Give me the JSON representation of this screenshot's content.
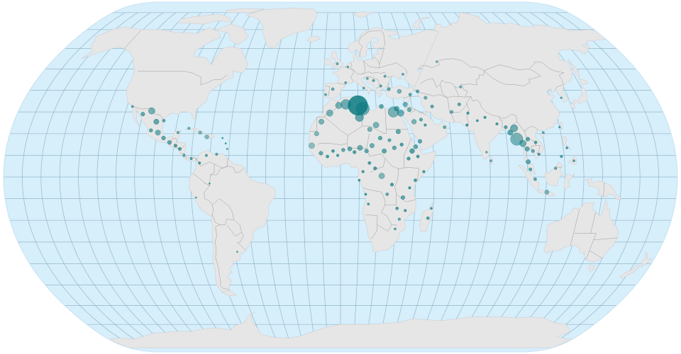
{
  "map": {
    "projection": "natural-earth",
    "colors": {
      "ocean": "#d7eefb",
      "ocean_edge": "#c8e4f4",
      "land": "#e6e6e6",
      "graticule": "#7fa7b8",
      "marker": "#0b7a80"
    },
    "graticule_step_deg": 10,
    "markers": [
      {
        "lon": 9.8,
        "lat": 33.0,
        "size": 6,
        "opacity": 0.85
      },
      {
        "lon": 12.5,
        "lat": 31.5,
        "size": 4,
        "opacity": 0.55
      },
      {
        "lon": 10.5,
        "lat": 27.5,
        "size": 2.5,
        "opacity": 0.6
      },
      {
        "lon": 3.0,
        "lat": 33.5,
        "size": 3,
        "opacity": 0.55
      },
      {
        "lon": -1.0,
        "lat": 33.0,
        "size": 2,
        "opacity": 0.5
      },
      {
        "lon": -6.0,
        "lat": 29.5,
        "size": 2,
        "opacity": 0.5
      },
      {
        "lon": -10.5,
        "lat": 25.5,
        "size": 1.6,
        "opacity": 0.5
      },
      {
        "lon": -13.0,
        "lat": 20.0,
        "size": 1.4,
        "opacity": 0.45
      },
      {
        "lon": -15.5,
        "lat": 14.5,
        "size": 1.8,
        "opacity": 0.4
      },
      {
        "lon": -10.5,
        "lat": 11.0,
        "size": 1.2,
        "opacity": 0.6
      },
      {
        "lon": -7.0,
        "lat": 9.5,
        "size": 0.9,
        "opacity": 0.7
      },
      {
        "lon": -4.0,
        "lat": 12.0,
        "size": 0.9,
        "opacity": 0.7
      },
      {
        "lon": -1.5,
        "lat": 10.0,
        "size": 0.8,
        "opacity": 0.7
      },
      {
        "lon": 1.5,
        "lat": 12.5,
        "size": 1.1,
        "opacity": 0.6
      },
      {
        "lon": 5.0,
        "lat": 13.0,
        "size": 1.3,
        "opacity": 0.6
      },
      {
        "lon": 7.5,
        "lat": 11.5,
        "size": 1.0,
        "opacity": 0.7
      },
      {
        "lon": 10.5,
        "lat": 13.5,
        "size": 1.6,
        "opacity": 0.55
      },
      {
        "lon": 14.0,
        "lat": 12.0,
        "size": 1.2,
        "opacity": 0.6
      },
      {
        "lon": 17.0,
        "lat": 14.5,
        "size": 1.4,
        "opacity": 0.55
      },
      {
        "lon": 16.0,
        "lat": 22.0,
        "size": 1.4,
        "opacity": 0.5
      },
      {
        "lon": 19.5,
        "lat": 24.0,
        "size": 1.8,
        "opacity": 0.5
      },
      {
        "lon": 21.5,
        "lat": 18.0,
        "size": 1.2,
        "opacity": 0.6
      },
      {
        "lon": 23.5,
        "lat": 12.0,
        "size": 1.4,
        "opacity": 0.6
      },
      {
        "lon": 26.5,
        "lat": 17.0,
        "size": 1.0,
        "opacity": 0.6
      },
      {
        "lon": 29.0,
        "lat": 13.5,
        "size": 1.2,
        "opacity": 0.6
      },
      {
        "lon": 31.5,
        "lat": 21.0,
        "size": 1.4,
        "opacity": 0.6
      },
      {
        "lon": 33.0,
        "lat": 15.0,
        "size": 1.0,
        "opacity": 0.7
      },
      {
        "lon": 29.5,
        "lat": 30.0,
        "size": 3.2,
        "opacity": 0.5
      },
      {
        "lon": 33.5,
        "lat": 29.5,
        "size": 2.0,
        "opacity": 0.55
      },
      {
        "lon": 31.5,
        "lat": 31.5,
        "size": 1.5,
        "opacity": 0.6
      },
      {
        "lon": 23.0,
        "lat": 32.5,
        "size": 1.3,
        "opacity": 0.6
      },
      {
        "lon": 36.5,
        "lat": 33.5,
        "size": 1.4,
        "opacity": 0.55
      },
      {
        "lon": 38.5,
        "lat": 31.0,
        "size": 1.2,
        "opacity": 0.55
      },
      {
        "lon": 40.5,
        "lat": 25.5,
        "size": 1.5,
        "opacity": 0.5
      },
      {
        "lon": 44.5,
        "lat": 26.5,
        "size": 1.0,
        "opacity": 0.6
      },
      {
        "lon": 46.5,
        "lat": 24.0,
        "size": 0.8,
        "opacity": 0.7
      },
      {
        "lon": 43.0,
        "lat": 16.5,
        "size": 1.2,
        "opacity": 0.6
      },
      {
        "lon": 40.5,
        "lat": 14.0,
        "size": 1.3,
        "opacity": 0.6
      },
      {
        "lon": 38.5,
        "lat": 12.0,
        "size": 1.5,
        "opacity": 0.65
      },
      {
        "lon": 36.5,
        "lat": 8.5,
        "size": 1.0,
        "opacity": 0.7
      },
      {
        "lon": 41.5,
        "lat": 9.5,
        "size": 0.9,
        "opacity": 0.7
      },
      {
        "lon": 44.5,
        "lat": 2.5,
        "size": 0.8,
        "opacity": 0.7
      },
      {
        "lon": 40.0,
        "lat": -1.5,
        "size": 0.9,
        "opacity": 0.7
      },
      {
        "lon": 37.0,
        "lat": -5.0,
        "size": 0.8,
        "opacity": 0.7
      },
      {
        "lon": 33.5,
        "lat": -9.5,
        "size": 1.2,
        "opacity": 0.6
      },
      {
        "lon": 30.5,
        "lat": -14.5,
        "size": 0.9,
        "opacity": 0.65
      },
      {
        "lon": 35.0,
        "lat": -15.5,
        "size": 0.8,
        "opacity": 0.7
      },
      {
        "lon": 32.0,
        "lat": -19.5,
        "size": 0.8,
        "opacity": 0.6
      },
      {
        "lon": 30.0,
        "lat": -24.0,
        "size": 0.7,
        "opacity": 0.6
      },
      {
        "lon": 27.5,
        "lat": -3.5,
        "size": 1.0,
        "opacity": 0.7
      },
      {
        "lon": 25.0,
        "lat": -8.0,
        "size": 0.9,
        "opacity": 0.6
      },
      {
        "lon": 22.0,
        "lat": 0.5,
        "size": 1.8,
        "opacity": 0.45
      },
      {
        "lon": 18.5,
        "lat": 4.0,
        "size": 1.0,
        "opacity": 0.7
      },
      {
        "lon": 15.5,
        "lat": 6.5,
        "size": 0.9,
        "opacity": 0.7
      },
      {
        "lon": 12.0,
        "lat": 2.5,
        "size": 0.8,
        "opacity": 0.7
      },
      {
        "lon": 10.0,
        "lat": -1.5,
        "size": 0.7,
        "opacity": 0.7
      },
      {
        "lon": 13.5,
        "lat": -8.0,
        "size": 0.7,
        "opacity": 0.7
      },
      {
        "lon": 15.0,
        "lat": -12.5,
        "size": 0.7,
        "opacity": 0.7
      },
      {
        "lon": 47.5,
        "lat": -19.0,
        "size": 0.9,
        "opacity": 0.65
      },
      {
        "lon": 49.0,
        "lat": -14.5,
        "size": 0.7,
        "opacity": 0.7
      },
      {
        "lon": 57.0,
        "lat": 23.0,
        "size": 0.9,
        "opacity": 0.6
      },
      {
        "lon": 62.0,
        "lat": 30.0,
        "size": 1.0,
        "opacity": 0.55
      },
      {
        "lon": 67.0,
        "lat": 33.5,
        "size": 1.0,
        "opacity": 0.6
      },
      {
        "lon": 71.0,
        "lat": 29.5,
        "size": 0.8,
        "opacity": 0.7
      },
      {
        "lon": 69.5,
        "lat": 24.0,
        "size": 0.8,
        "opacity": 0.7
      },
      {
        "lon": 75.5,
        "lat": 26.0,
        "size": 0.7,
        "opacity": 0.7
      },
      {
        "lon": 80.0,
        "lat": 27.5,
        "size": 0.8,
        "opacity": 0.7
      },
      {
        "lon": 86.0,
        "lat": 24.5,
        "size": 0.8,
        "opacity": 0.7
      },
      {
        "lon": 90.5,
        "lat": 23.0,
        "size": 1.0,
        "opacity": 0.65
      },
      {
        "lon": 92.5,
        "lat": 20.5,
        "size": 1.6,
        "opacity": 0.6
      },
      {
        "lon": 95.0,
        "lat": 22.5,
        "size": 2.2,
        "opacity": 0.55
      },
      {
        "lon": 95.5,
        "lat": 17.5,
        "size": 3.8,
        "opacity": 0.5
      },
      {
        "lon": 98.5,
        "lat": 15.5,
        "size": 2.0,
        "opacity": 0.55
      },
      {
        "lon": 100.5,
        "lat": 13.0,
        "size": 1.4,
        "opacity": 0.6
      },
      {
        "lon": 101.5,
        "lat": 17.5,
        "size": 1.2,
        "opacity": 0.6
      },
      {
        "lon": 103.5,
        "lat": 12.0,
        "size": 1.0,
        "opacity": 0.6
      },
      {
        "lon": 105.5,
        "lat": 16.0,
        "size": 0.9,
        "opacity": 0.65
      },
      {
        "lon": 100.5,
        "lat": 7.0,
        "size": 1.4,
        "opacity": 0.6
      },
      {
        "lon": 101.5,
        "lat": 3.5,
        "size": 1.0,
        "opacity": 0.6
      },
      {
        "lon": 106.5,
        "lat": 10.5,
        "size": 0.8,
        "opacity": 0.7
      },
      {
        "lon": 104.0,
        "lat": -1.0,
        "size": 0.9,
        "opacity": 0.6
      },
      {
        "lon": 110.5,
        "lat": -7.0,
        "size": 1.3,
        "opacity": 0.5
      },
      {
        "lon": 118.5,
        "lat": 9.5,
        "size": 0.8,
        "opacity": 0.65
      },
      {
        "lon": 122.0,
        "lat": 13.5,
        "size": 0.7,
        "opacity": 0.65
      },
      {
        "lon": 125.0,
        "lat": 7.5,
        "size": 0.7,
        "opacity": 0.65
      },
      {
        "lon": 115.0,
        "lat": 4.0,
        "size": 0.8,
        "opacity": 0.6
      },
      {
        "lon": 120.0,
        "lat": 23.0,
        "size": 0.6,
        "opacity": 0.6
      },
      {
        "lon": 126.0,
        "lat": 36.5,
        "size": 0.6,
        "opacity": 0.6
      },
      {
        "lon": 110.5,
        "lat": 20.5,
        "size": 0.7,
        "opacity": 0.6
      },
      {
        "lon": 48.5,
        "lat": 36.5,
        "size": 1.0,
        "opacity": 0.55
      },
      {
        "lon": 51.5,
        "lat": 32.5,
        "size": 1.0,
        "opacity": 0.6
      },
      {
        "lon": 44.5,
        "lat": 39.5,
        "size": 1.0,
        "opacity": 0.6
      },
      {
        "lon": 40.0,
        "lat": 38.0,
        "size": 0.9,
        "opacity": 0.6
      },
      {
        "lon": 34.0,
        "lat": 39.5,
        "size": 1.3,
        "opacity": 0.5
      },
      {
        "lon": 28.0,
        "lat": 40.5,
        "size": 1.0,
        "opacity": 0.6
      },
      {
        "lon": 23.5,
        "lat": 42.0,
        "size": 0.8,
        "opacity": 0.6
      },
      {
        "lon": 19.5,
        "lat": 44.5,
        "size": 0.8,
        "opacity": 0.6
      },
      {
        "lon": 16.0,
        "lat": 45.5,
        "size": 0.7,
        "opacity": 0.6
      },
      {
        "lon": 26.5,
        "lat": 46.5,
        "size": 0.7,
        "opacity": 0.6
      },
      {
        "lon": 37.5,
        "lat": 47.5,
        "size": 0.7,
        "opacity": 0.6
      },
      {
        "lon": 13.5,
        "lat": 41.0,
        "size": 0.7,
        "opacity": 0.6
      },
      {
        "lon": 3.0,
        "lat": 43.5,
        "size": 0.7,
        "opacity": 0.6
      },
      {
        "lon": -4.5,
        "lat": 40.5,
        "size": 0.9,
        "opacity": 0.55
      },
      {
        "lon": -8.5,
        "lat": 38.0,
        "size": 0.7,
        "opacity": 0.6
      },
      {
        "lon": -2.0,
        "lat": 52.5,
        "size": 0.8,
        "opacity": 0.55
      },
      {
        "lon": 4.5,
        "lat": 51.0,
        "size": 0.6,
        "opacity": 0.6
      },
      {
        "lon": 60.0,
        "lat": 53.5,
        "size": 0.6,
        "opacity": 0.6
      },
      {
        "lon": 70.0,
        "lat": 41.5,
        "size": 0.7,
        "opacity": 0.6
      },
      {
        "lon": 78.5,
        "lat": 11.5,
        "size": 0.6,
        "opacity": 0.6
      },
      {
        "lon": 80.5,
        "lat": 7.5,
        "size": 0.7,
        "opacity": 0.6
      },
      {
        "lon": -105.5,
        "lat": 30.5,
        "size": 2.0,
        "opacity": 0.5
      },
      {
        "lon": -101.5,
        "lat": 25.5,
        "size": 1.6,
        "opacity": 0.6
      },
      {
        "lon": -110.0,
        "lat": 29.0,
        "size": 1.2,
        "opacity": 0.6
      },
      {
        "lon": -99.5,
        "lat": 20.5,
        "size": 1.6,
        "opacity": 0.55
      },
      {
        "lon": -103.5,
        "lat": 21.5,
        "size": 1.1,
        "opacity": 0.6
      },
      {
        "lon": -96.0,
        "lat": 18.0,
        "size": 1.2,
        "opacity": 0.6
      },
      {
        "lon": -92.5,
        "lat": 16.0,
        "size": 1.2,
        "opacity": 0.6
      },
      {
        "lon": -89.0,
        "lat": 14.5,
        "size": 1.0,
        "opacity": 0.65
      },
      {
        "lon": -86.5,
        "lat": 13.0,
        "size": 1.0,
        "opacity": 0.65
      },
      {
        "lon": -84.0,
        "lat": 10.0,
        "size": 0.8,
        "opacity": 0.65
      },
      {
        "lon": -80.0,
        "lat": 8.5,
        "size": 0.8,
        "opacity": 0.65
      },
      {
        "lon": -75.5,
        "lat": 6.5,
        "size": 0.8,
        "opacity": 0.65
      },
      {
        "lon": -72.0,
        "lat": 10.0,
        "size": 0.8,
        "opacity": 0.6
      },
      {
        "lon": -66.5,
        "lat": 10.5,
        "size": 0.8,
        "opacity": 0.6
      },
      {
        "lon": -76.5,
        "lat": 20.5,
        "size": 1.0,
        "opacity": 0.5
      },
      {
        "lon": -72.5,
        "lat": 18.5,
        "size": 1.2,
        "opacity": 0.45
      },
      {
        "lon": -83.0,
        "lat": 22.5,
        "size": 0.8,
        "opacity": 0.5
      },
      {
        "lon": -64.0,
        "lat": 18.0,
        "size": 0.5,
        "opacity": 0.7
      },
      {
        "lon": -62.0,
        "lat": 15.5,
        "size": 0.5,
        "opacity": 0.7
      },
      {
        "lon": -61.0,
        "lat": 13.0,
        "size": 0.5,
        "opacity": 0.7
      },
      {
        "lon": -88.5,
        "lat": 20.5,
        "size": 0.8,
        "opacity": 0.6
      },
      {
        "lon": -97.5,
        "lat": 26.0,
        "size": 0.9,
        "opacity": 0.6
      },
      {
        "lon": -70.0,
        "lat": -3.0,
        "size": 0.5,
        "opacity": 0.6
      },
      {
        "lon": -77.5,
        "lat": -9.5,
        "size": 0.5,
        "opacity": 0.6
      },
      {
        "lon": -58.5,
        "lat": -34.5,
        "size": 0.5,
        "opacity": 0.6
      },
      {
        "lon": -117.0,
        "lat": 32.5,
        "size": 0.7,
        "opacity": 0.6
      }
    ]
  }
}
